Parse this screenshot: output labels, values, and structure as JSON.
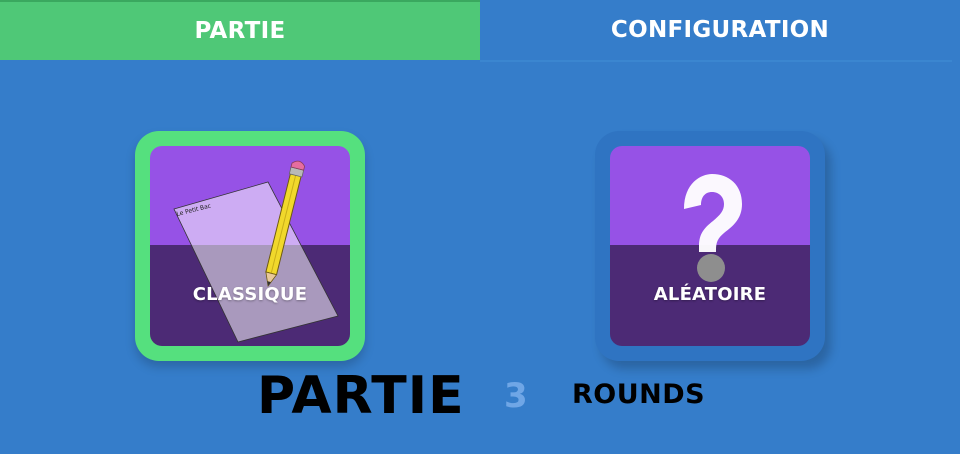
{
  "tabs": [
    {
      "label": "PARTIE",
      "active": true
    },
    {
      "label": "CONFIGURATION",
      "active": false
    }
  ],
  "modes": [
    {
      "label": "CLASSIQUE",
      "icon": "paper-and-pencil-icon",
      "paper_text": "Le Petit Bac",
      "selected": true
    },
    {
      "label": "ALÉATOIRE",
      "icon": "question-mark-icon",
      "selected": false
    }
  ],
  "footer": {
    "title": "PARTIE",
    "rounds_count": "3",
    "rounds_label": "ROUNDS"
  },
  "colors": {
    "background": "#357DCA",
    "active_tab": "#4FC877",
    "selected_border": "#55E07E",
    "card_top": "#9652E6",
    "card_bottom": "#4C2A75",
    "count_text": "#6FA6E6"
  }
}
